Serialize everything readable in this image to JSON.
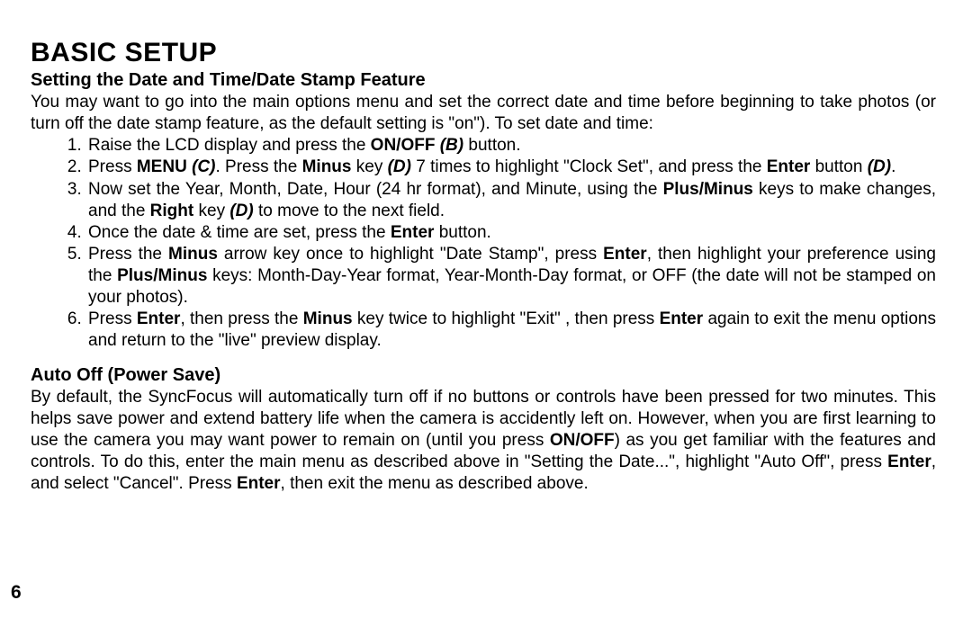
{
  "page": {
    "number": "6",
    "title": "BASIC SETUP",
    "section1": {
      "heading": "Setting the Date and Time/Date Stamp Feature",
      "intro_html": "You may want to go into the main options menu and set the correct date and time before beginning to take photos (or turn off the date stamp feature, as the default setting is \"on\"). To set date and time:",
      "steps_html": [
        "Raise the LCD display and press the <span class='b'>ON/OFF</span> <span class='bi'>(B)</span> button.",
        "Press <span class='b'>MENU</span> <span class='bi'>(C)</span>. Press the <span class='b'>Minus</span> key <span class='bi'>(D)</span> 7 times to highlight \"Clock Set\", and press the <span class='b'>Enter</span> button <span class='bi'>(D)</span>.",
        "Now set the Year, Month, Date, Hour (24 hr format), and Minute, using the <span class='b'>Plus/Minus</span> keys to make changes, and the <span class='b'>Right</span> key <span class='bi'>(D)</span> to move to the next field.",
        "Once the date & time are set, press the <span class='b'>Enter</span> button.",
        "Press the <span class='b'>Minus</span> arrow key once to highlight \"Date Stamp\", press <span class='b'>Enter</span>, then highlight your preference using the <span class='b'>Plus/Minus</span> keys: Month-Day-Year format, Year-Month-Day format, or OFF (the date will not be stamped on your photos).",
        "Press <span class='b'>Enter</span>, then press the <span class='b'>Minus</span> key twice to highlight \"Exit\" , then press <span class='b'>Enter</span> again to exit the menu options and return to the \"live\" preview display."
      ]
    },
    "section2": {
      "heading": "Auto Off (Power Save)",
      "body_html": "By default, the SyncFocus will automatically turn off if no buttons or controls have been pressed for two minutes. This helps save power and extend battery life when the camera is accidently left on.  However, when you are first learning to use the camera you may want power to remain on (until you press <span class='b'>ON/OFF</span>) as you get familiar with the features and controls. To do this, enter the main menu as described above in \"Setting the Date...\", highlight \"Auto Off\", press <span class='b'>Enter</span>, and select \"Cancel\". Press <span class='b'>Enter</span>, then exit the menu as described above."
    }
  }
}
